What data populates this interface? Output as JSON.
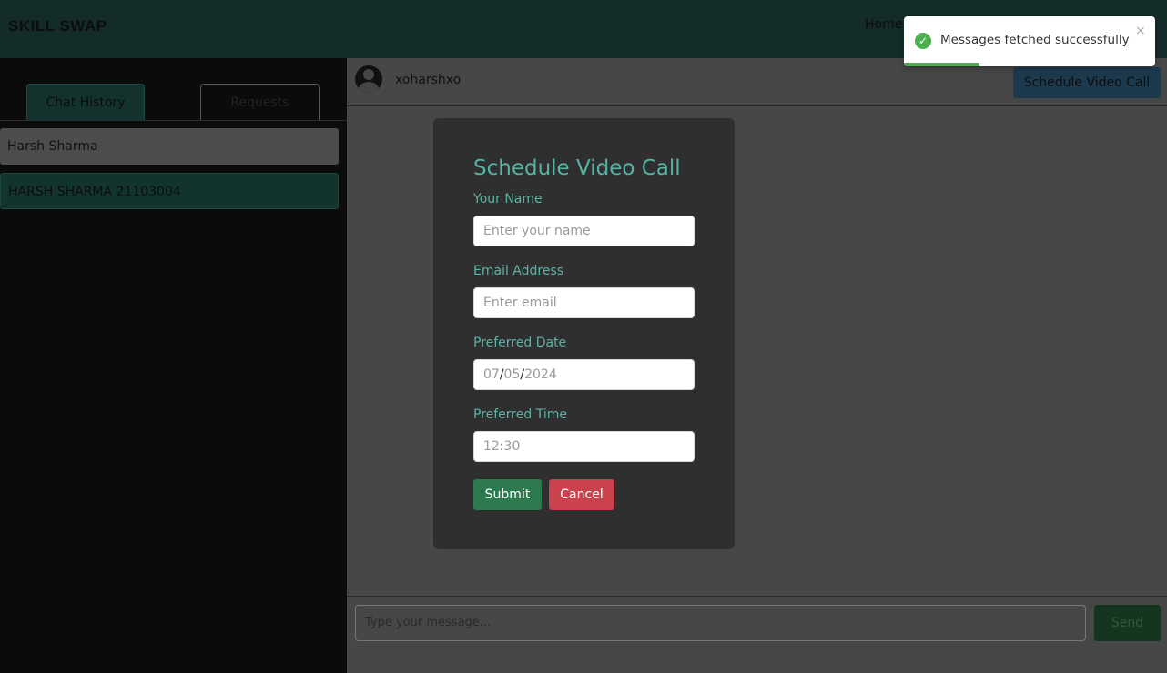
{
  "header": {
    "brand": "SKILL SWAP",
    "nav_home": "Home"
  },
  "sidebar": {
    "tabs": [
      {
        "label": "Chat History",
        "active": true
      },
      {
        "label": "Requests",
        "active": false
      }
    ],
    "chats": [
      {
        "name": "Harsh Sharma"
      },
      {
        "name": "HARSH SHARMA 21103004"
      }
    ]
  },
  "chat": {
    "username": "xoharshxo",
    "schedule_button": "Schedule Video Call"
  },
  "modal": {
    "title": "Schedule Video Call",
    "fields": {
      "name": {
        "label": "Your Name",
        "placeholder": "Enter your name"
      },
      "email": {
        "label": "Email Address",
        "placeholder": "Enter email"
      },
      "date": {
        "label": "Preferred Date",
        "month": "07",
        "day": "05",
        "year": "2024",
        "sep": "/"
      },
      "time": {
        "label": "Preferred Time",
        "hour": "12",
        "minute": "30",
        "sep": ":"
      }
    },
    "submit": "Submit",
    "cancel": "Cancel"
  },
  "composer": {
    "placeholder": "Type your message...",
    "send": "Send"
  },
  "toast": {
    "message": "Messages fetched successfully",
    "close": "×",
    "progress": 0.3,
    "status_color": "#4caf50",
    "icon": "check-circle-icon"
  },
  "colors": {
    "accent": "#55b3a5",
    "submit": "#2d7a4f",
    "cancel": "#c9424c"
  }
}
